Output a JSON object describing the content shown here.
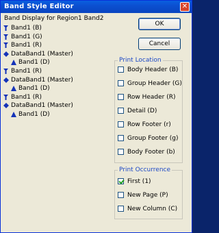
{
  "window": {
    "title": "Band Style Editor"
  },
  "header_label": "Band Display for Region1  Band2",
  "tree": [
    {
      "label": "Band1 (B)",
      "icon": "funnel-icon",
      "indent": 0
    },
    {
      "label": "Band1 (G)",
      "icon": "funnel-icon",
      "indent": 0
    },
    {
      "label": "Band1 (R)",
      "icon": "funnel-icon",
      "indent": 0
    },
    {
      "label": "DataBand1 (Master)",
      "icon": "diamond-icon",
      "indent": 0
    },
    {
      "label": "Band1 (D)",
      "icon": "triangle-icon",
      "indent": 1
    },
    {
      "label": "Band1 (R)",
      "icon": "funnel-icon",
      "indent": 0
    },
    {
      "label": "DataBand1 (Master)",
      "icon": "diamond-icon",
      "indent": 0
    },
    {
      "label": "Band1 (D)",
      "icon": "triangle-icon",
      "indent": 1
    },
    {
      "label": "Band1 (R)",
      "icon": "funnel-icon",
      "indent": 0
    },
    {
      "label": "DataBand1 (Master)",
      "icon": "diamond-icon",
      "indent": 0
    },
    {
      "label": "Band1 (D)",
      "icon": "triangle-icon",
      "indent": 1
    }
  ],
  "buttons": {
    "ok": "OK",
    "cancel": "Cancel"
  },
  "print_location": {
    "title": "Print Location",
    "items": [
      {
        "label": "Body Header (B)",
        "checked": false
      },
      {
        "label": "Group Header (G)",
        "checked": false
      },
      {
        "label": "Row Header (R)",
        "checked": false
      },
      {
        "label": "Detail (D)",
        "checked": false
      },
      {
        "label": "Row Footer (r)",
        "checked": false
      },
      {
        "label": "Group Footer (g)",
        "checked": false
      },
      {
        "label": "Body Footer (b)",
        "checked": false
      }
    ]
  },
  "print_occurrence": {
    "title": "Print Occurrence",
    "items": [
      {
        "label": "First (1)",
        "checked": true
      },
      {
        "label": "New Page (P)",
        "checked": false
      },
      {
        "label": "New Column (C)",
        "checked": false
      }
    ]
  },
  "colors": {
    "title_bar": "#0a5fe0",
    "group_title": "#1c48c6",
    "icon_blue": "#1533b8"
  }
}
